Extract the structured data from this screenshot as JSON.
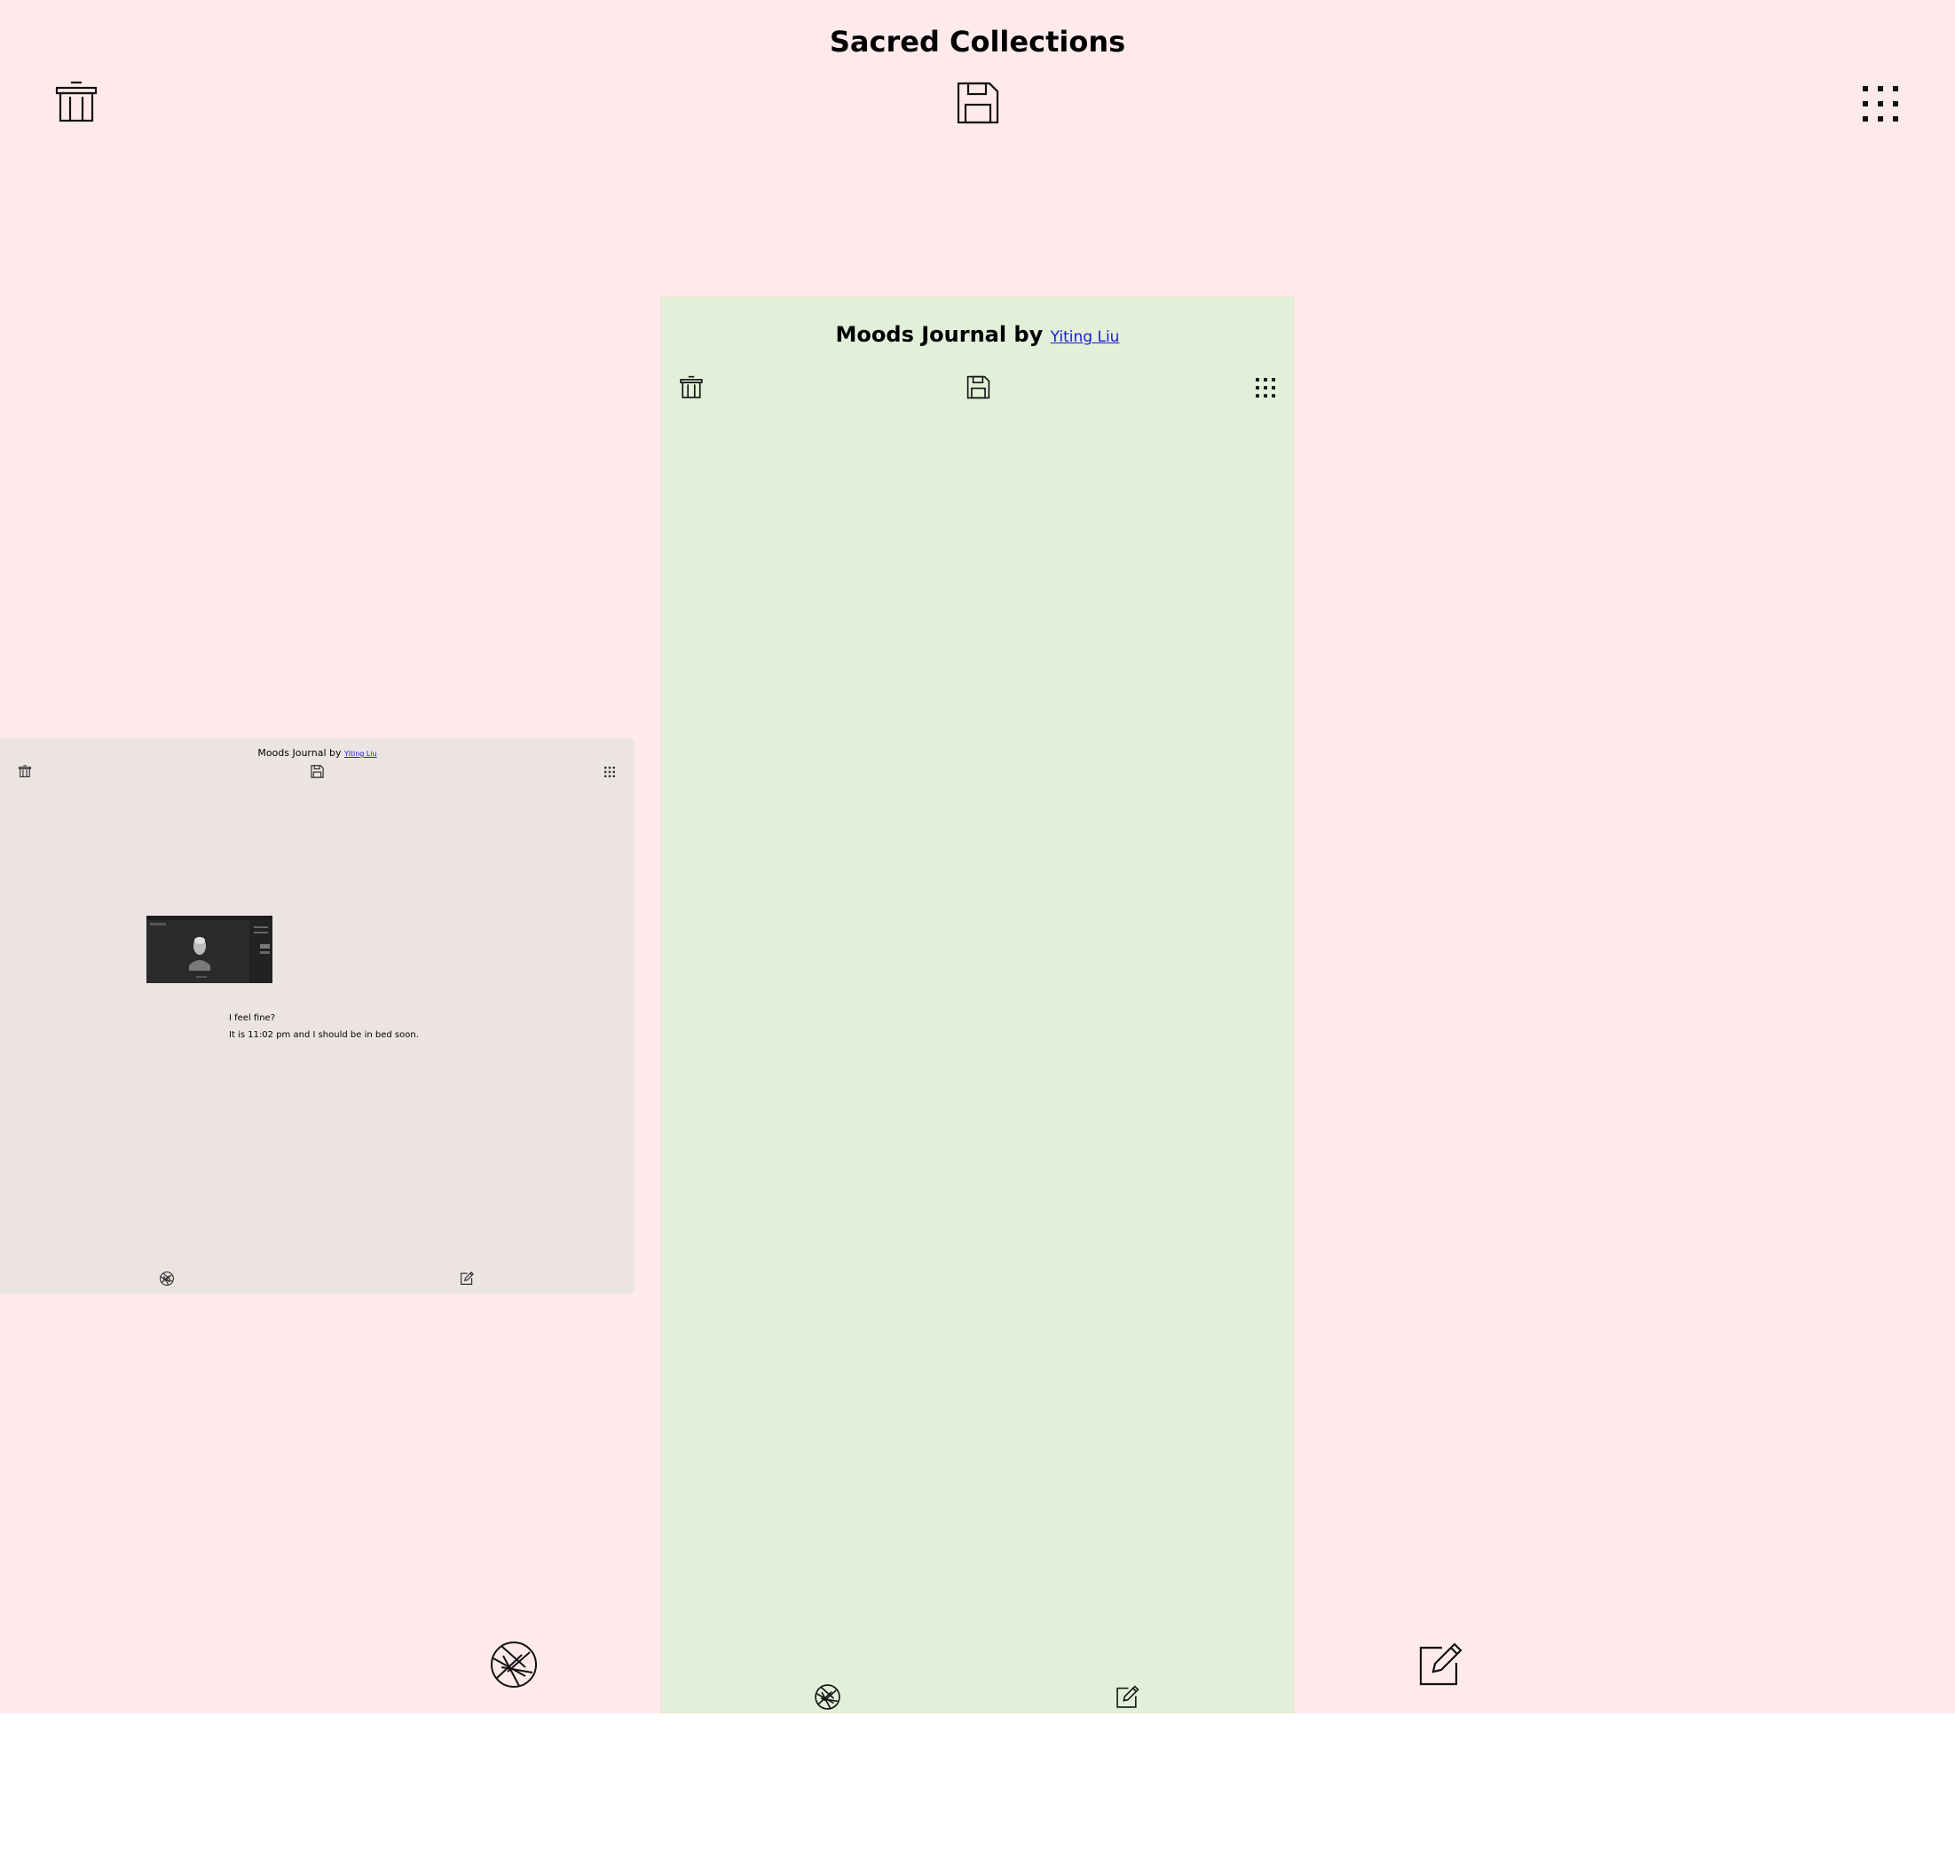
{
  "app": {
    "title": "Sacred Collections",
    "icons": {
      "trash": "trash-icon",
      "save": "floppy-disk-icon",
      "apps": "grid-icon",
      "camera": "aperture-icon",
      "edit": "edit-note-icon"
    }
  },
  "journal_main": {
    "title_prefix": "Moods Journal by ",
    "author": "Yiting Liu"
  },
  "journal_card": {
    "title_prefix": "Moods Journal by ",
    "author": "Yiting Liu",
    "entry_lines": [
      "I feel fine?",
      "It is 11:02 pm and I should be in bed soon."
    ]
  },
  "colors": {
    "background": "#feeaec",
    "journal_panel": "#e2f0d9",
    "card_panel": "#ece4e3",
    "link": "#1a1ad6"
  }
}
